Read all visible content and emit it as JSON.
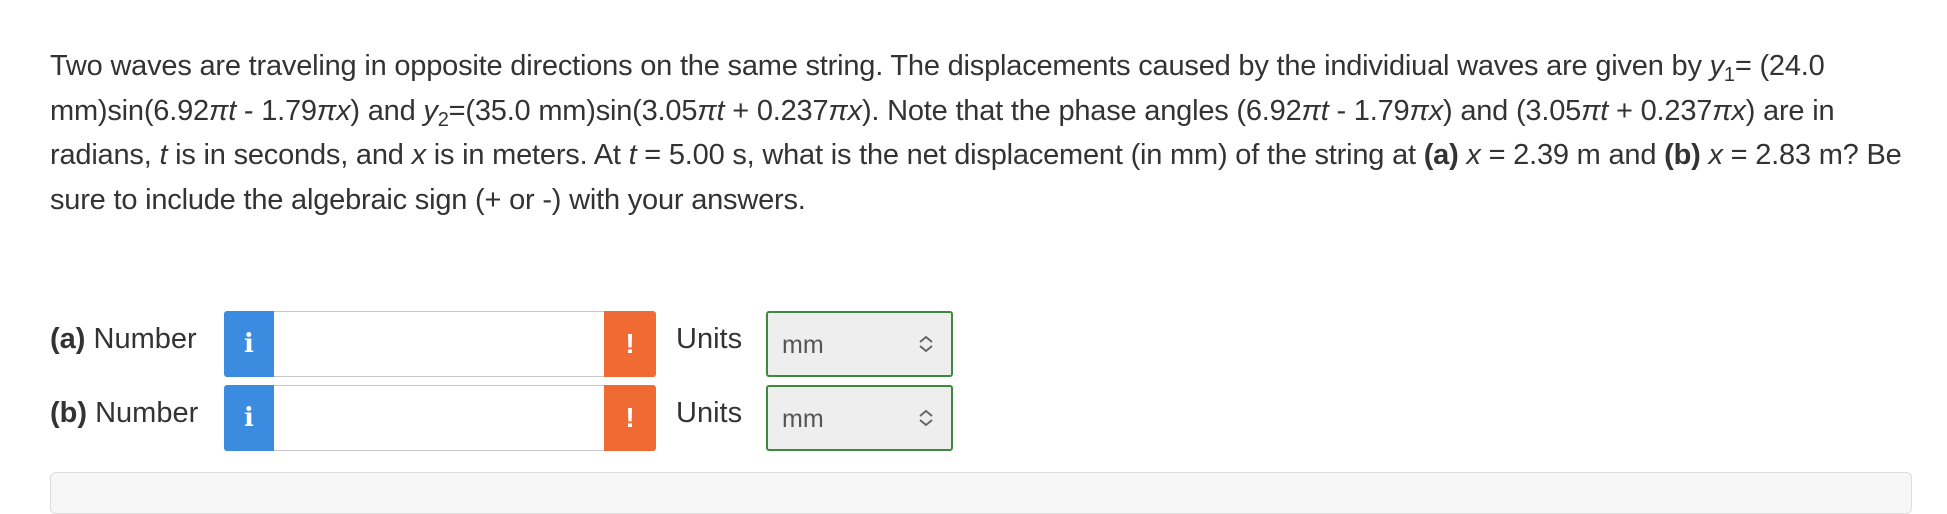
{
  "question": {
    "p1": "Two waves are traveling in opposite directions on the same string. The displacements caused by the individiual waves are given by ",
    "y": "y",
    "sub1": "1",
    "p2": "= (24.0 mm)sin(6.92",
    "pi": "π",
    "t": "t",
    "x": "x",
    "p3": " - 1.79",
    "p4": ") and ",
    "sub2": "2",
    "p5": "=(35.0 mm)sin(3.05",
    "p6": " + 0.237",
    "p7": "). Note that the phase angles (6.92",
    "p8": ") and (3.05",
    "p9": ") are in radians, ",
    "p10": " is in seconds, and ",
    "p11": " is in meters. At ",
    "p12": " = 5.00 s, what is the net displacement (in mm) of the string at ",
    "part_a": "(a)",
    "p13": " = 2.39 m and ",
    "part_b": "(b)",
    "p14": " = 2.83 m? Be sure to include the algebraic sign (+ or -) with your answers."
  },
  "answers": [
    {
      "part": "(a)",
      "label": " Number",
      "info_icon": "i",
      "value": "",
      "warn_icon": "!",
      "units_label": "Units",
      "units_value": "mm"
    },
    {
      "part": "(b)",
      "label": " Number",
      "info_icon": "i",
      "value": "",
      "warn_icon": "!",
      "units_label": "Units",
      "units_value": "mm"
    }
  ],
  "colors": {
    "info_button": "#3b8be0",
    "warning_button": "#ef6b33",
    "units_border": "#3d8a3d"
  }
}
